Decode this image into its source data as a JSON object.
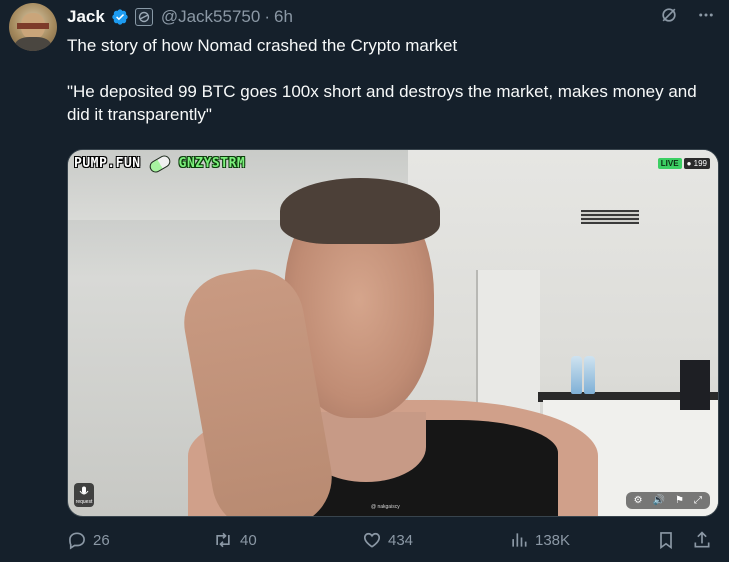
{
  "post": {
    "author": {
      "name": "Jack",
      "handle": "@Jack55750",
      "separator": "·",
      "time": "6h"
    },
    "text": {
      "line1": "The story of how Nomad crashed the Crypto market",
      "quote": "\"He deposited 99 BTC goes 100x short and destroys the market, makes money and did it transparently\""
    },
    "media": {
      "overlay_left": "PUMP.FUN",
      "overlay_right": "GNZYSTRM",
      "live_label": "LIVE",
      "viewers": "199",
      "request_label": "request",
      "watermark": "@ nakgaiscy"
    },
    "actions": {
      "replies": "26",
      "retweets": "40",
      "likes": "434",
      "views": "138K"
    }
  },
  "icons": {
    "verified": "verified-badge-icon",
    "org_badge": "affiliate-badge-icon",
    "grok": "grok-icon",
    "more": "more-icon",
    "reply": "reply-icon",
    "retweet": "retweet-icon",
    "like": "heart-icon",
    "views": "views-icon",
    "bookmark": "bookmark-icon",
    "share": "share-icon"
  },
  "colors": {
    "background": "#15202b",
    "text_primary": "#f7f9f9",
    "text_secondary": "#8b98a5",
    "verified": "#1d9bf0",
    "live": "#3ccf63",
    "overlay_green": "#7cf07c"
  }
}
